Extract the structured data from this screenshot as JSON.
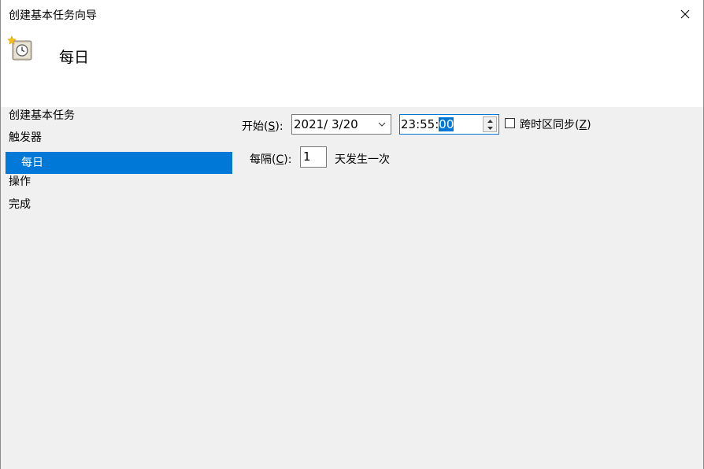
{
  "window": {
    "title": "创建基本任务向导"
  },
  "header": {
    "title": "每日",
    "icon": "task-scheduler-clock-icon"
  },
  "steps": [
    {
      "label": "创建基本任务",
      "selected": false
    },
    {
      "label": "触发器",
      "selected": false
    },
    {
      "label": "每日",
      "selected": true
    },
    {
      "label": "操作",
      "selected": false
    },
    {
      "label": "完成",
      "selected": false
    }
  ],
  "trigger": {
    "start_label": "开始(",
    "start_key": "S",
    "start_label_end": "):",
    "date_value": "2021/  3/20",
    "time_value_prefix": "23:55:",
    "time_value_selected": "00",
    "sync_label": "跨时区同步(",
    "sync_key": "Z",
    "sync_label_end": ")",
    "sync_checked": false,
    "interval_label": "每隔(",
    "interval_key": "C",
    "interval_label_end": "):",
    "interval_value": "1",
    "interval_suffix": "天发生一次"
  },
  "colors": {
    "selection": "#0078d7",
    "panel_bg": "#f0f0f0",
    "header_bg": "#ffffff"
  }
}
